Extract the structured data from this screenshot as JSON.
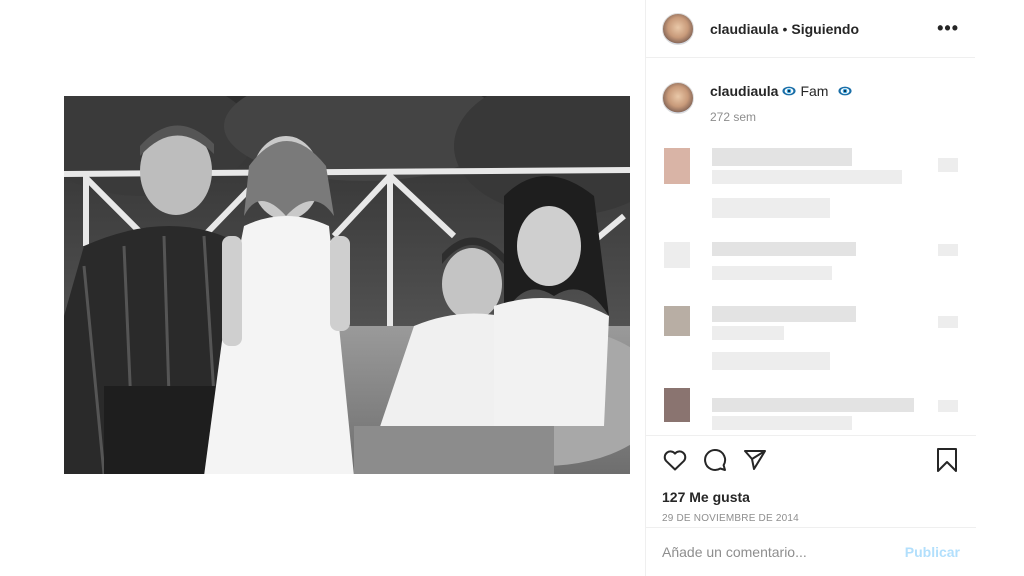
{
  "post": {
    "photo_label": "family-photo"
  },
  "header": {
    "username": "claudiaula",
    "separator": "•",
    "follow_status": "Siguiendo",
    "more_label": "•••"
  },
  "caption": {
    "username": "claudiaula",
    "text": "Fam",
    "emoji_icon": "evil-eye-nazar-icon",
    "time": "272 sem"
  },
  "actions": {
    "like_icon": "heart-icon",
    "comment_icon": "comment-icon",
    "share_icon": "paper-plane-icon",
    "save_icon": "bookmark-icon"
  },
  "likes": "127 Me gusta",
  "date": "29 DE NOVIEMBRE DE 2014",
  "comment_box": {
    "placeholder": "Añade un comentario...",
    "publish_label": "Publicar"
  },
  "colors": {
    "link_disabled": "#b2dffc",
    "muted_text": "#8e8e8e",
    "border": "#efefef",
    "emoji_blue": "#1b6fa8"
  }
}
